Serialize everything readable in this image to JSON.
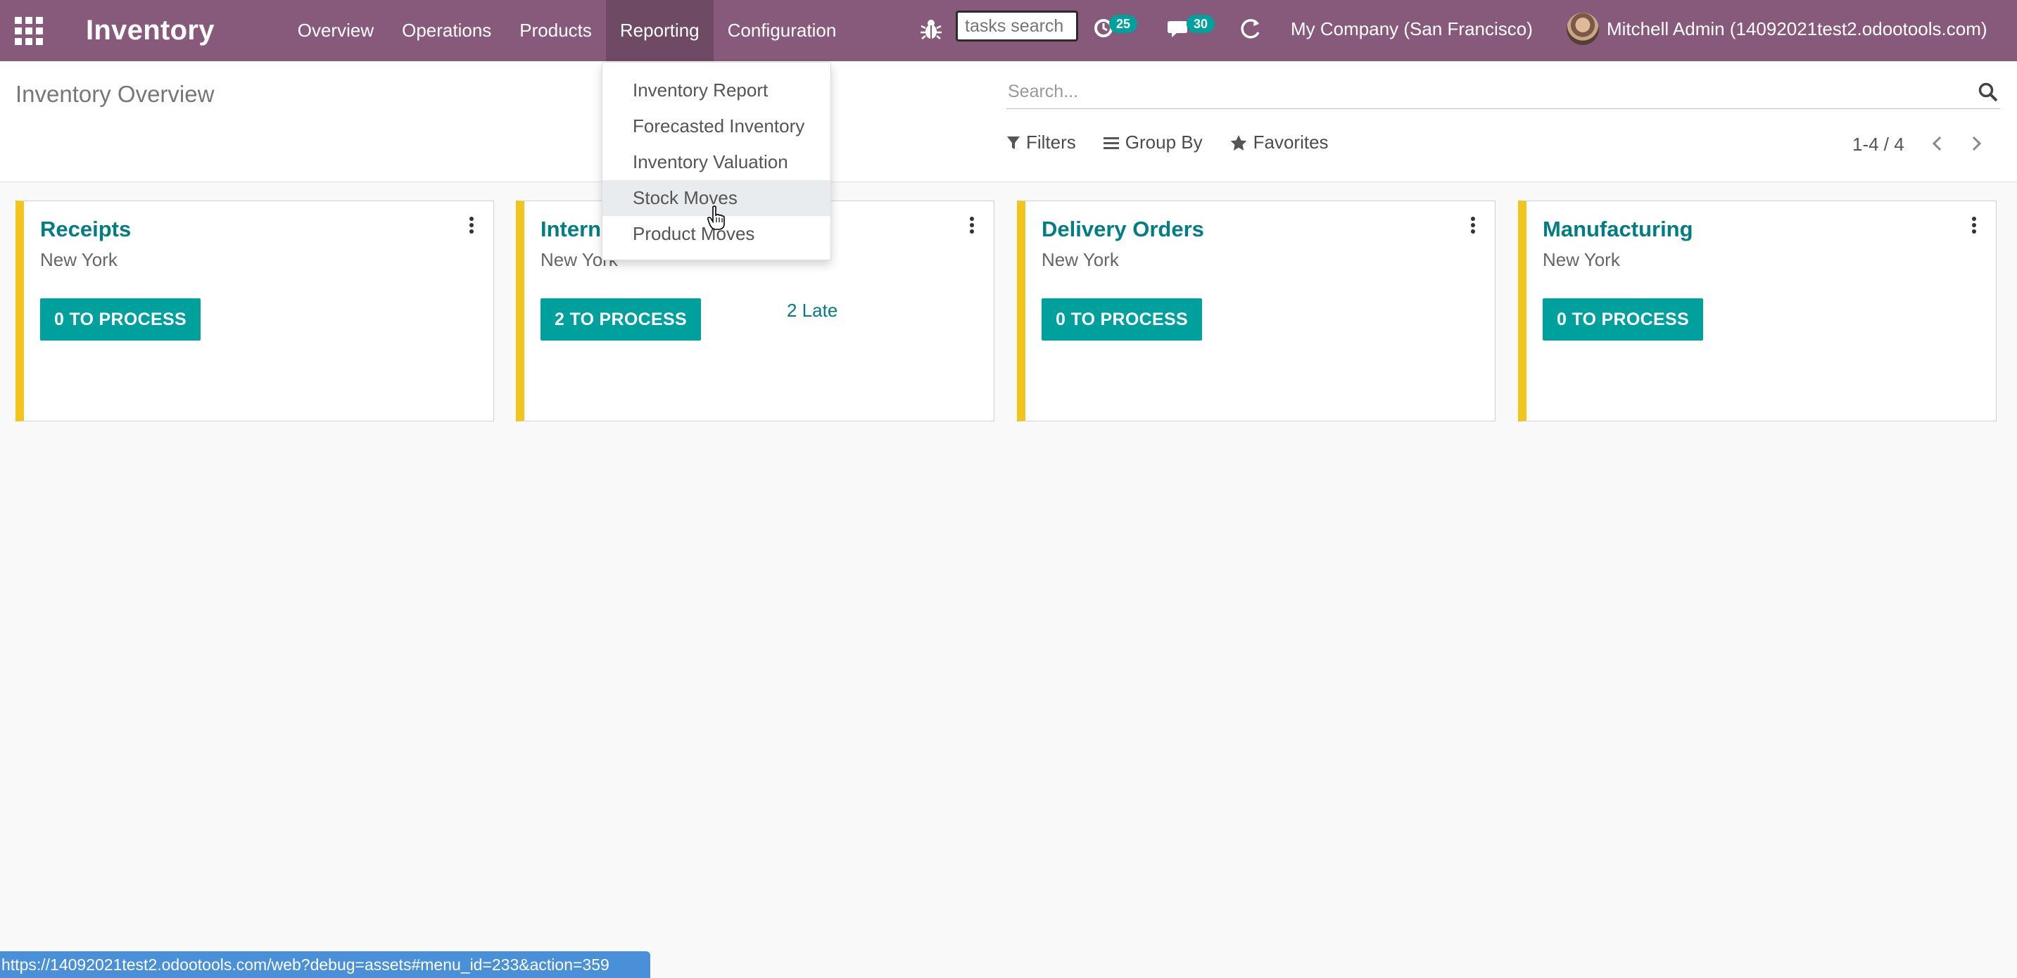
{
  "app": {
    "brand": "Inventory",
    "menu": [
      {
        "label": "Overview"
      },
      {
        "label": "Operations"
      },
      {
        "label": "Products"
      },
      {
        "label": "Reporting"
      },
      {
        "label": "Configuration"
      }
    ],
    "tasks_search_placeholder": "tasks search",
    "activity_count": "25",
    "message_count": "30",
    "company": "My Company (San Francisco)",
    "user": "Mitchell Admin (14092021test2.odootools.com)"
  },
  "reporting_dropdown": {
    "items": [
      {
        "label": "Inventory Report"
      },
      {
        "label": "Forecasted Inventory"
      },
      {
        "label": "Inventory Valuation"
      },
      {
        "label": "Stock Moves"
      },
      {
        "label": "Product Moves"
      }
    ]
  },
  "control_panel": {
    "title": "Inventory Overview",
    "search_placeholder": "Search...",
    "filters_label": "Filters",
    "group_by_label": "Group By",
    "favorites_label": "Favorites",
    "pager": "1-4 / 4"
  },
  "cards": [
    {
      "title": "Receipts",
      "location": "New York",
      "button": "0 TO PROCESS",
      "late": ""
    },
    {
      "title": "Internal Transfers",
      "location": "New York",
      "button": "2 TO PROCESS",
      "late": "2 Late"
    },
    {
      "title": "Delivery Orders",
      "location": "New York",
      "button": "0 TO PROCESS",
      "late": ""
    },
    {
      "title": "Manufacturing",
      "location": "New York",
      "button": "0 TO PROCESS",
      "late": ""
    }
  ],
  "status_url": "https://14092021test2.odootools.com/web?debug=assets#menu_id=233&action=359",
  "colors": {
    "navbar": "#875a7b",
    "navbar_active": "#6e4a64",
    "accent": "#00a09d",
    "title_link": "#017e84",
    "card_border": "#f2c51c",
    "statusbar": "#4a90d9"
  },
  "icons": [
    "apps-grid-icon",
    "bug-icon",
    "activity-clock-icon",
    "chat-icon",
    "refresh-icon",
    "search-icon",
    "filter-icon",
    "group-by-icon",
    "star-icon",
    "chevron-left-icon",
    "chevron-right-icon",
    "kebab-menu-icon",
    "hand-pointer-icon"
  ]
}
